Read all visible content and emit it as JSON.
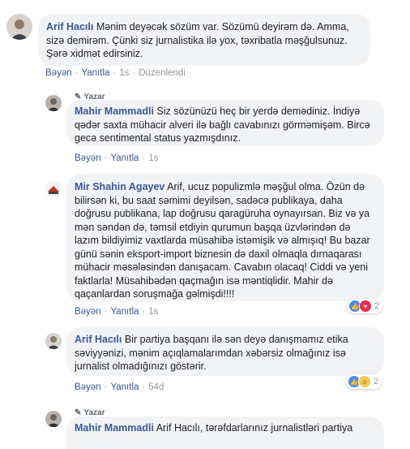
{
  "comments": [
    {
      "author": "Arif Hacılı",
      "text": " Mənim deyəcək sözüm var. Sözümü deyirəm də. Amma, sizə demirəm. Çünki siz jurnalistika ilə yox, təxribatla məşğulsunuz. Şərə xidmət edirsiniz.",
      "like": "Bəyən",
      "reply": "Yanıtla",
      "time": "1s",
      "edited": "Düzenlendi"
    },
    {
      "badge": "Yazar",
      "author": "Mahir Mammadli",
      "text": " Siz sözünüzü heç bir yerdə demədiniz. İndiyə qədər saxta mühacir alveri ilə bağlı cavabınızı görməmişəm. Bircə gecə sentimental status yazmışdınız.",
      "like": "Bəyən",
      "reply": "Yanıtla",
      "time": "1s"
    },
    {
      "author": "Mir Shahin Agayev",
      "text": " Arif, ucuz populizmlə məşğul olma. Özün də bilirsən ki, bu saat səmimi deyilsən, sadəcə publikaya, daha doğrusu publikana, lap doğrusu qaragüruha oynayırsan. Biz və ya mən səndən də, təmsil etdiyin qurumun başqa üzvlərindən də lazım bildiyimiz vaxtlarda müsahibə istəmişik və almışıq! Bu bazar günü sənin eksport-import biznesin də daxil olmaqla dırnaqarası mühacir məsələsindən danışacam. Cavabın olacaq! Ciddi və yeni faktlarla! Müsahibədən qaçmağın isə məntiqlidir. Mahir də qaçanlardan soruşmağa gəlmişdi!!!!",
      "like": "Bəyən",
      "reply": "Yanıtla",
      "time": "1s",
      "reaction_count": "2"
    },
    {
      "author": "Arif Hacılı",
      "text": " Bir partiya başqanı ilə sən deyə danışmamız etika səviyyənizi, mənim açıqlamalarımdan xəbərsiz olmağınız isə jurnalist olmadığınızı göstərir.",
      "like": "Bəyən",
      "reply": "Yanıtla",
      "time": "54d",
      "reaction_count": "2"
    },
    {
      "badge": "Yazar",
      "author": "Mahir Mammadli",
      "text": " Arif Hacılı, tərəfdarlarınız jurnalistləri partiya"
    }
  ],
  "colors": {
    "author": "#385898",
    "bubble": "#f2f3f5",
    "meta": "#90949c"
  },
  "icons": {
    "badge": "pencil-icon",
    "like": "like-reaction-icon",
    "love": "love-reaction-icon",
    "haha": "haha-reaction-icon"
  }
}
